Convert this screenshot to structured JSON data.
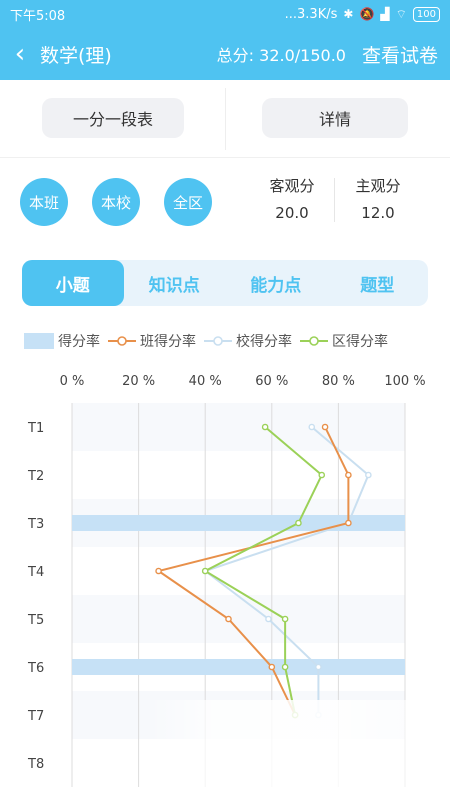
{
  "status": {
    "time": "下午5:08",
    "speed": "...3.3K/s",
    "battery": "100"
  },
  "header": {
    "title": "数学(理)",
    "total": "总分: 32.0/150.0",
    "view_paper": "查看试卷"
  },
  "buttons": {
    "table": "一分一段表",
    "detail": "详情"
  },
  "scope": [
    "本班",
    "本校",
    "全区"
  ],
  "scores": {
    "objective_label": "客观分",
    "objective_value": "20.0",
    "subjective_label": "主观分",
    "subjective_value": "12.0"
  },
  "tabs": [
    "小题",
    "知识点",
    "能力点",
    "题型"
  ],
  "colors": {
    "accent": "#4fc3f1",
    "bar": "#c6e1f6",
    "class": "#e8904a",
    "school": "#c9dff0",
    "district": "#9bd158"
  },
  "chart_data": {
    "type": "bar",
    "orientation": "horizontal",
    "categories": [
      "T1",
      "T2",
      "T3",
      "T4",
      "T5",
      "T6",
      "T7",
      "T8"
    ],
    "xlim": [
      0,
      100
    ],
    "x_ticks": [
      "0 %",
      "20 %",
      "40 %",
      "60 %",
      "80 %",
      "100 %"
    ],
    "legend": [
      "得分率",
      "班得分率",
      "校得分率",
      "区得分率"
    ],
    "series": [
      {
        "name": "得分率",
        "kind": "bar",
        "values": [
          0,
          0,
          100,
          0,
          0,
          100,
          0,
          0
        ]
      },
      {
        "name": "班得分率",
        "kind": "line",
        "values": [
          76,
          83,
          83,
          26,
          47,
          60,
          67,
          null
        ]
      },
      {
        "name": "校得分率",
        "kind": "line",
        "values": [
          72,
          89,
          83,
          40,
          59,
          74,
          74,
          null
        ]
      },
      {
        "name": "区得分率",
        "kind": "line",
        "values": [
          58,
          75,
          68,
          40,
          64,
          64,
          67,
          null
        ]
      }
    ]
  }
}
